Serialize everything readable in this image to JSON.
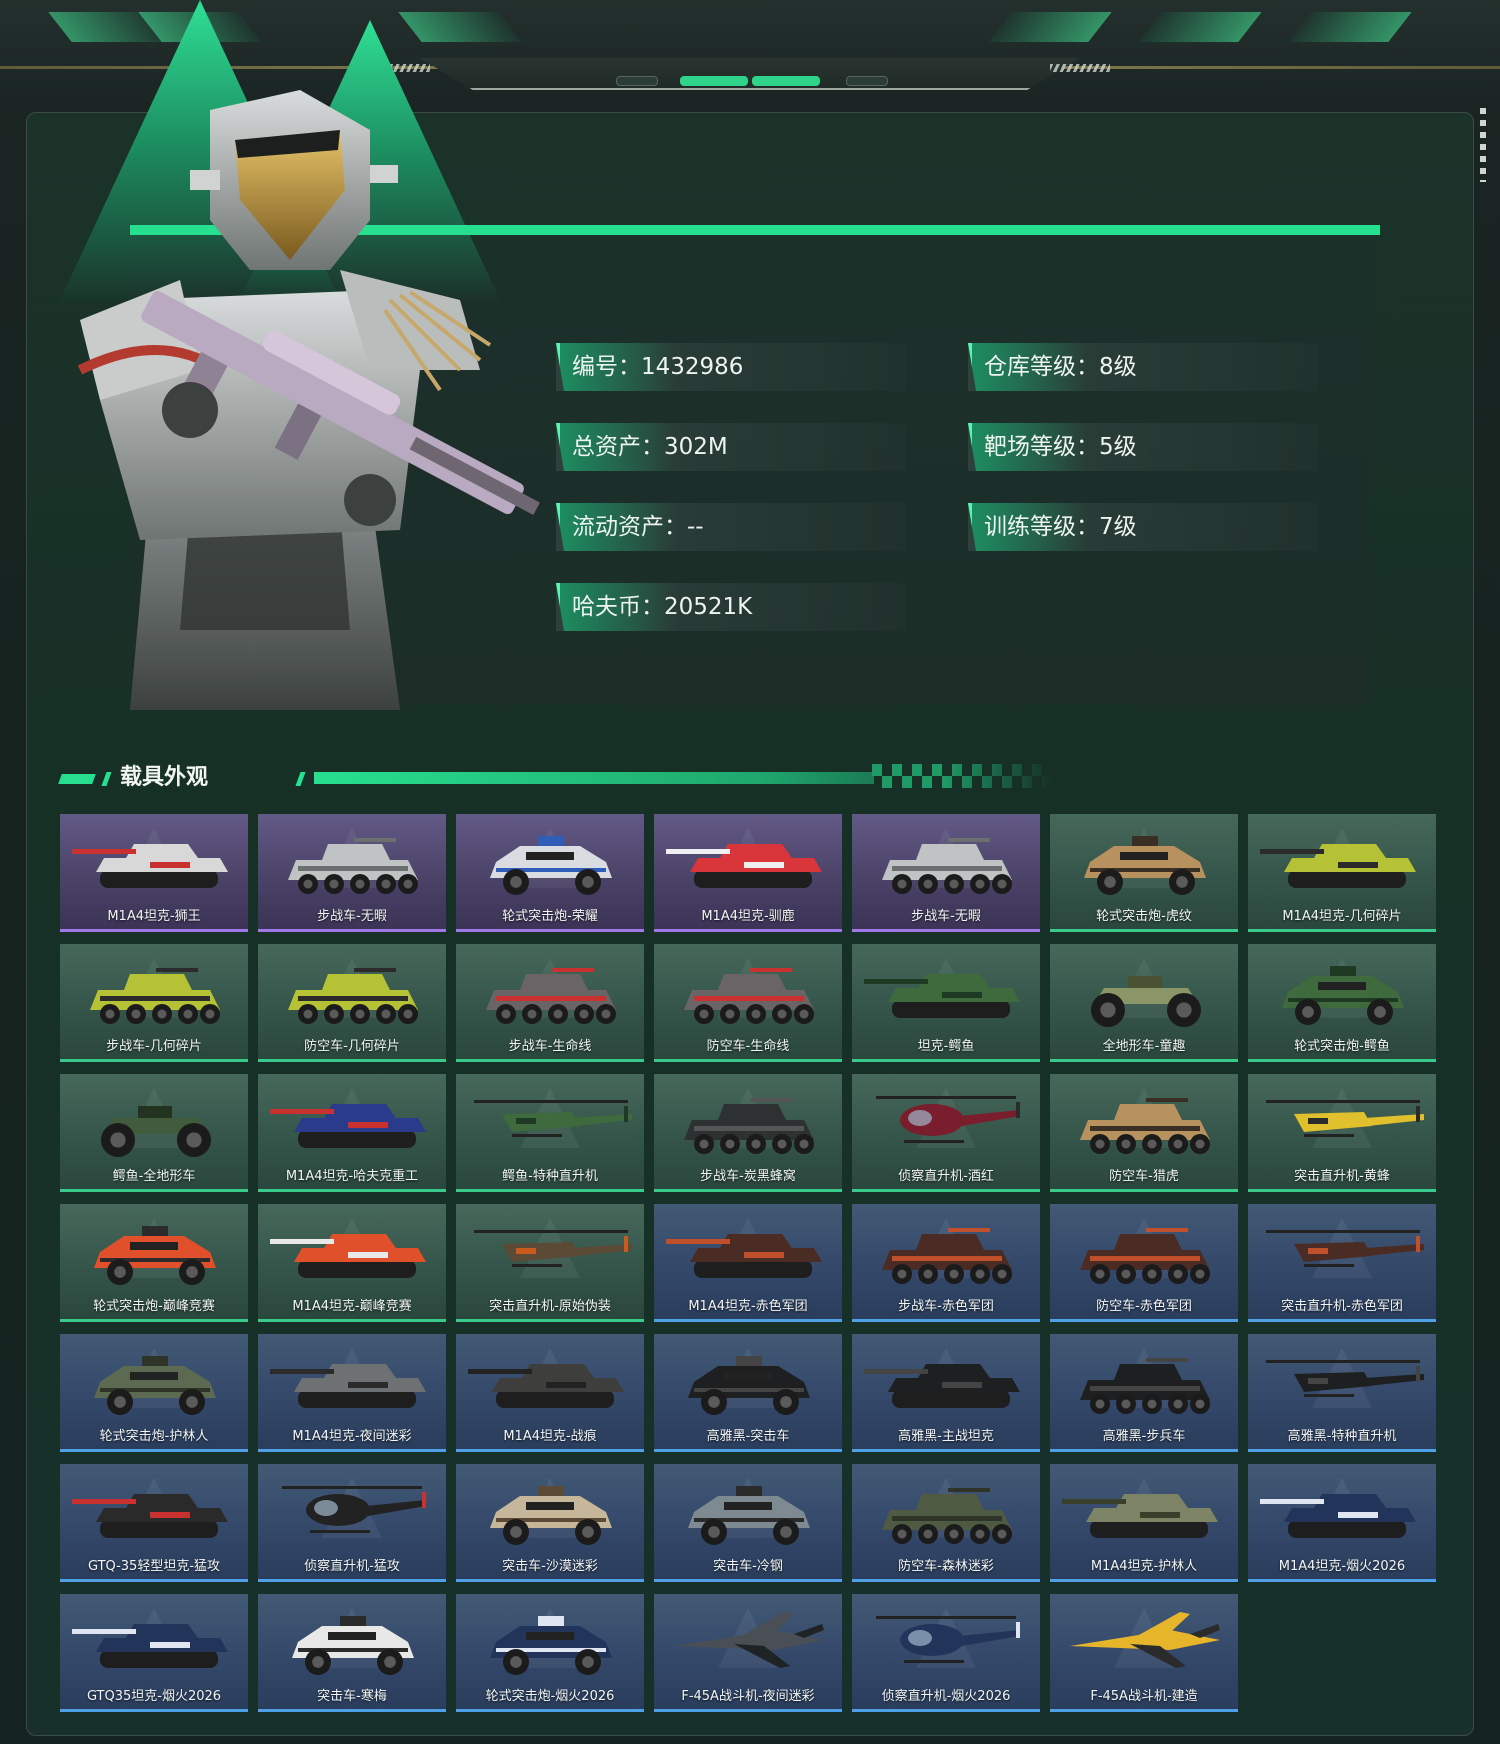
{
  "profile": {
    "id_label": "编号：1432986",
    "total_assets_label": "总资产：302M",
    "liquid_assets_label": "流动资产：--",
    "haf_coin_label": "哈夫币：20521K",
    "warehouse_level_label": "仓库等级：8级",
    "range_level_label": "靶场等级：5级",
    "training_level_label": "训练等级：7级"
  },
  "section": {
    "title": "载具外观"
  },
  "colors": {
    "accent": "#27e08f",
    "purple_rarity": "#9e78e6",
    "green_rarity": "#39c98a",
    "blue_rarity": "#4fa0e6"
  },
  "vehicles": [
    {
      "name": "M1A4坦克-狮王",
      "rarity": "purple",
      "kind": "tank",
      "paint": "#d8d8d8",
      "accent": "#c93030"
    },
    {
      "name": "步战车-无暇",
      "rarity": "purple",
      "kind": "ifv",
      "paint": "#bfc3c4",
      "accent": "#6b6f70"
    },
    {
      "name": "轮式突击炮-荣耀",
      "rarity": "purple",
      "kind": "car",
      "paint": "#d9dde2",
      "accent": "#2f5db8"
    },
    {
      "name": "M1A4坦克-驯鹿",
      "rarity": "purple",
      "kind": "tank",
      "paint": "#d8363a",
      "accent": "#f0f0f0"
    },
    {
      "name": "步战车-无暇",
      "rarity": "purple",
      "kind": "ifv",
      "paint": "#bfc3c4",
      "accent": "#6b6f70"
    },
    {
      "name": "轮式突击炮-虎纹",
      "rarity": "green",
      "kind": "car",
      "paint": "#b8925e",
      "accent": "#3a2f24"
    },
    {
      "name": "M1A4坦克-几何碎片",
      "rarity": "green",
      "kind": "tank",
      "paint": "#b6c235",
      "accent": "#2b2b2b"
    },
    {
      "name": "步战车-几何碎片",
      "rarity": "green",
      "kind": "ifv",
      "paint": "#b6c235",
      "accent": "#2b2b2b"
    },
    {
      "name": "防空车-几何碎片",
      "rarity": "green",
      "kind": "ifv",
      "paint": "#b6c235",
      "accent": "#2b2b2b"
    },
    {
      "name": "步战车-生命线",
      "rarity": "green",
      "kind": "ifv",
      "paint": "#6a6466",
      "accent": "#c93030"
    },
    {
      "name": "防空车-生命线",
      "rarity": "green",
      "kind": "ifv",
      "paint": "#6a6466",
      "accent": "#c93030"
    },
    {
      "name": "坦克-鳄鱼",
      "rarity": "green",
      "kind": "tank",
      "paint": "#3e6a3e",
      "accent": "#1f3a22"
    },
    {
      "name": "全地形车-童趣",
      "rarity": "green",
      "kind": "atv",
      "paint": "#8a9568",
      "accent": "#4a5233"
    },
    {
      "name": "轮式突击炮-鳄鱼",
      "rarity": "green",
      "kind": "car",
      "paint": "#3e6a3e",
      "accent": "#1f3a22"
    },
    {
      "name": "鳄鱼-全地形车",
      "rarity": "green",
      "kind": "atv",
      "paint": "#405c3c",
      "accent": "#22331f"
    },
    {
      "name": "M1A4坦克-哈夫克重工",
      "rarity": "green",
      "kind": "tank",
      "paint": "#2b3b8c",
      "accent": "#c93030"
    },
    {
      "name": "鳄鱼-特种直升机",
      "rarity": "green",
      "kind": "heli",
      "paint": "#3e6a3e",
      "accent": "#1f3a22"
    },
    {
      "name": "步战车-炭黑蜂窝",
      "rarity": "green",
      "kind": "ifv",
      "paint": "#2e3132",
      "accent": "#555"
    },
    {
      "name": "侦察直升机-酒红",
      "rarity": "green",
      "kind": "smallheli",
      "paint": "#7a1d2c",
      "accent": "#2b2b2b"
    },
    {
      "name": "防空车-猎虎",
      "rarity": "green",
      "kind": "ifv",
      "paint": "#b8925e",
      "accent": "#3a2f24"
    },
    {
      "name": "突击直升机-黄蜂",
      "rarity": "green",
      "kind": "heli",
      "paint": "#e1c02d",
      "accent": "#2b2b2b"
    },
    {
      "name": "轮式突击炮-巅峰竞赛",
      "rarity": "green",
      "kind": "car",
      "paint": "#e0502b",
      "accent": "#2b2b2b"
    },
    {
      "name": "M1A4坦克-巅峰竞赛",
      "rarity": "green",
      "kind": "tank",
      "paint": "#e0502b",
      "accent": "#e8e8e8"
    },
    {
      "name": "突击直升机-原始伪装",
      "rarity": "green",
      "kind": "heli",
      "paint": "#5a4a36",
      "accent": "#c85a1e"
    },
    {
      "name": "M1A4坦克-赤色军团",
      "rarity": "blue",
      "kind": "tank",
      "paint": "#4a2c24",
      "accent": "#c0502b"
    },
    {
      "name": "步战车-赤色军团",
      "rarity": "blue",
      "kind": "ifv",
      "paint": "#4a2c24",
      "accent": "#c0502b"
    },
    {
      "name": "防空车-赤色军团",
      "rarity": "blue",
      "kind": "ifv",
      "paint": "#4a2c24",
      "accent": "#c0502b"
    },
    {
      "name": "突击直升机-赤色军团",
      "rarity": "blue",
      "kind": "heli",
      "paint": "#4a2c24",
      "accent": "#c0502b"
    },
    {
      "name": "轮式突击炮-护林人",
      "rarity": "blue",
      "kind": "car",
      "paint": "#5d6a52",
      "accent": "#2e3528"
    },
    {
      "name": "M1A4坦克-夜间迷彩",
      "rarity": "blue",
      "kind": "tank",
      "paint": "#6d7174",
      "accent": "#2b2b2b"
    },
    {
      "name": "M1A4坦克-战痕",
      "rarity": "blue",
      "kind": "tank",
      "paint": "#3e3f3c",
      "accent": "#222"
    },
    {
      "name": "高雅黑-突击车",
      "rarity": "blue",
      "kind": "car",
      "paint": "#1d1f21",
      "accent": "#444"
    },
    {
      "name": "高雅黑-主战坦克",
      "rarity": "blue",
      "kind": "tank",
      "paint": "#1d1f21",
      "accent": "#444"
    },
    {
      "name": "高雅黑-步兵车",
      "rarity": "blue",
      "kind": "ifv",
      "paint": "#1d1f21",
      "accent": "#444"
    },
    {
      "name": "高雅黑-特种直升机",
      "rarity": "blue",
      "kind": "heli",
      "paint": "#1d1f21",
      "accent": "#444"
    },
    {
      "name": "GTQ-35轻型坦克-猛攻",
      "rarity": "blue",
      "kind": "tank",
      "paint": "#2a2a2a",
      "accent": "#c93030"
    },
    {
      "name": "侦察直升机-猛攻",
      "rarity": "blue",
      "kind": "smallheli",
      "paint": "#222",
      "accent": "#c93030"
    },
    {
      "name": "突击车-沙漠迷彩",
      "rarity": "blue",
      "kind": "car",
      "paint": "#c7b79a",
      "accent": "#5a4a36"
    },
    {
      "name": "突击车-冷钢",
      "rarity": "blue",
      "kind": "car",
      "paint": "#7e8a92",
      "accent": "#2b2b2b"
    },
    {
      "name": "防空车-森林迷彩",
      "rarity": "blue",
      "kind": "ifv",
      "paint": "#4f5a42",
      "accent": "#2e3528"
    },
    {
      "name": "M1A4坦克-护林人",
      "rarity": "blue",
      "kind": "tank",
      "paint": "#7d8365",
      "accent": "#3a3f2c"
    },
    {
      "name": "M1A4坦克-烟火2026",
      "rarity": "blue",
      "kind": "tank",
      "paint": "#23345a",
      "accent": "#dfe6f2"
    },
    {
      "name": "GTQ35坦克-烟火2026",
      "rarity": "blue",
      "kind": "tank",
      "paint": "#23345a",
      "accent": "#dfe6f2"
    },
    {
      "name": "突击车-寒梅",
      "rarity": "blue",
      "kind": "car",
      "paint": "#e8e8e8",
      "accent": "#2b2b2b"
    },
    {
      "name": "轮式突击炮-烟火2026",
      "rarity": "blue",
      "kind": "car",
      "paint": "#23345a",
      "accent": "#dfe6f2"
    },
    {
      "name": "F-45A战斗机-夜间迷彩",
      "rarity": "blue",
      "kind": "jet",
      "paint": "#4a4e55",
      "accent": "#202326"
    },
    {
      "name": "侦察直升机-烟火2026",
      "rarity": "blue",
      "kind": "smallheli",
      "paint": "#23345a",
      "accent": "#dfe6f2"
    },
    {
      "name": "F-45A战斗机-建造",
      "rarity": "blue",
      "kind": "jet",
      "paint": "#e6b52a",
      "accent": "#2b2b2b"
    }
  ]
}
